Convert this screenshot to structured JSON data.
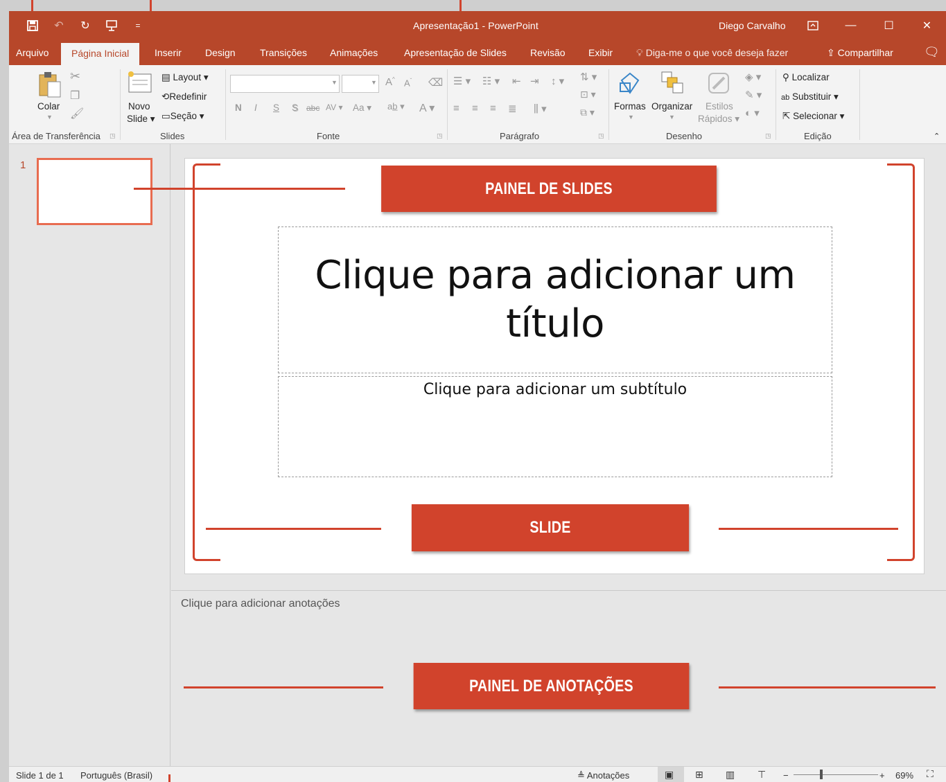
{
  "window": {
    "title": "Apresentação1  -  PowerPoint",
    "user": "Diego Carvalho"
  },
  "qat": {
    "more": "="
  },
  "tabs": [
    {
      "label": "Arquivo"
    },
    {
      "label": "Página Inicial"
    },
    {
      "label": "Inserir"
    },
    {
      "label": "Design"
    },
    {
      "label": "Transições"
    },
    {
      "label": "Animações"
    },
    {
      "label": "Apresentação de Slides"
    },
    {
      "label": "Revisão"
    },
    {
      "label": "Exibir"
    }
  ],
  "tell_me": "Diga-me o que você deseja fazer",
  "share": "Compartilhar",
  "ribbon": {
    "clipboard": {
      "paste": "Colar",
      "label": "Área de Transferência"
    },
    "slides": {
      "new_line1": "Novo",
      "new_line2": "Slide",
      "layout": "Layout",
      "reset": "Redefinir",
      "section": "Seção",
      "label": "Slides"
    },
    "font": {
      "bold": "N",
      "italic": "I",
      "underline": "S",
      "shadow": "S",
      "strike": "abc",
      "spacing": "AV",
      "case": "Aa",
      "color": "A",
      "label": "Fonte"
    },
    "paragraph": {
      "label": "Parágrafo"
    },
    "drawing": {
      "shapes": "Formas",
      "arrange": "Organizar",
      "styles_line1": "Estilos",
      "styles_line2": "Rápidos",
      "label": "Desenho"
    },
    "editing": {
      "find": "Localizar",
      "replace": "Substituir",
      "select": "Selecionar",
      "label": "Edição"
    }
  },
  "slides_pane": {
    "number": "1"
  },
  "slide": {
    "title_placeholder": "Clique para adicionar um título",
    "subtitle_placeholder": "Clique para adicionar um subtítulo"
  },
  "notes": {
    "placeholder": "Clique para adicionar anotações"
  },
  "status": {
    "slide_count": "Slide 1 de 1",
    "language": "Português (Brasil)",
    "notes_toggle": "Anotações",
    "zoom": "69%"
  },
  "callouts": {
    "slides_panel": "PAINEL DE SLIDES",
    "slide": "SLIDE",
    "notes_panel": "PAINEL DE ANOTAÇÕES"
  },
  "colors": {
    "accent": "#b7472a",
    "callout": "#d1432c"
  }
}
